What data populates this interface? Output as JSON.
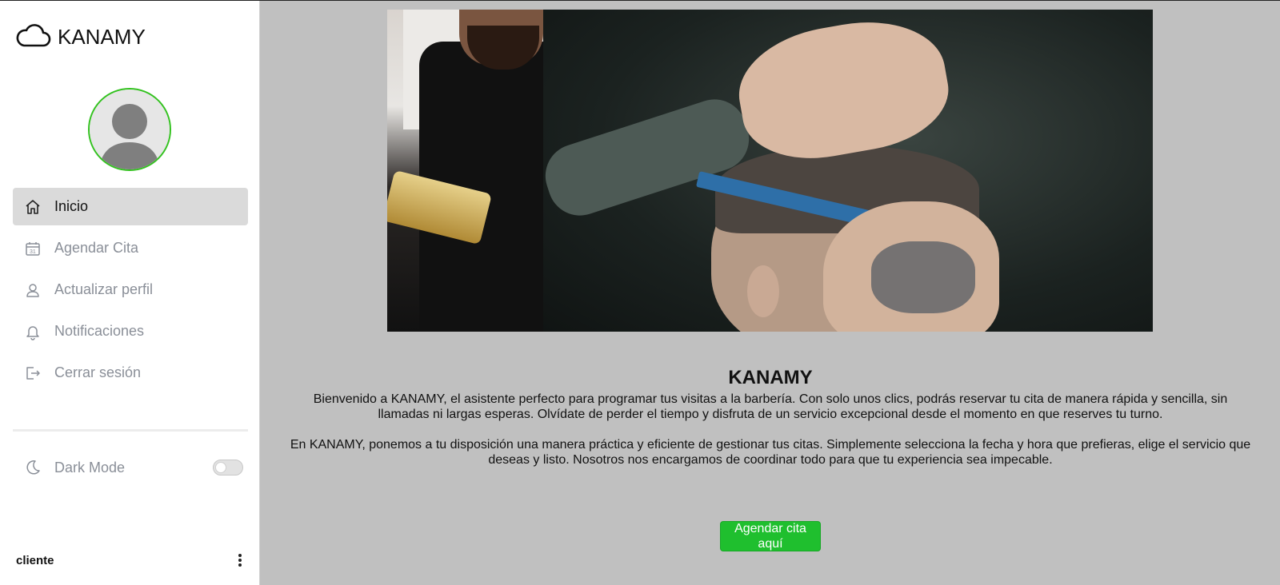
{
  "app": {
    "brand_name": "KANAMY",
    "brand_icon": "cloud-icon",
    "accent_color": "#1fbf2e",
    "avatar_ring_color": "#33c21f"
  },
  "sidebar": {
    "items": [
      {
        "label": "Inicio",
        "icon": "home-icon",
        "active": true
      },
      {
        "label": "Agendar Cita",
        "icon": "calendar-icon",
        "active": false
      },
      {
        "label": "Actualizar perfil",
        "icon": "user-icon",
        "active": false
      },
      {
        "label": "Notificaciones",
        "icon": "bell-icon",
        "active": false
      },
      {
        "label": "Cerrar sesión",
        "icon": "logout-icon",
        "active": false
      }
    ],
    "dark_mode": {
      "label": "Dark Mode",
      "icon": "moon-icon",
      "enabled": false
    },
    "user": {
      "name": "cliente",
      "menu_icon": "more-vertical-icon"
    }
  },
  "main": {
    "title": "KANAMY",
    "paragraph_1": "Bienvenido a KANAMY, el asistente perfecto para programar tus visitas a la barbería. Con solo unos clics, podrás reservar tu cita de manera rápida y sencilla, sin llamadas ni largas esperas. Olvídate de perder el tiempo y disfruta de un servicio excepcional desde el momento en que reserves tu turno.",
    "paragraph_2": "En KANAMY, ponemos a tu disposición una manera práctica y eficiente de gestionar tus citas. Simplemente selecciona la fecha y hora que prefieras, elige el servicio que deseas y listo. Nosotros nos encargamos de coordinar todo para que tu experiencia sea impecable.",
    "cta_label": "Agendar cita aquí"
  }
}
